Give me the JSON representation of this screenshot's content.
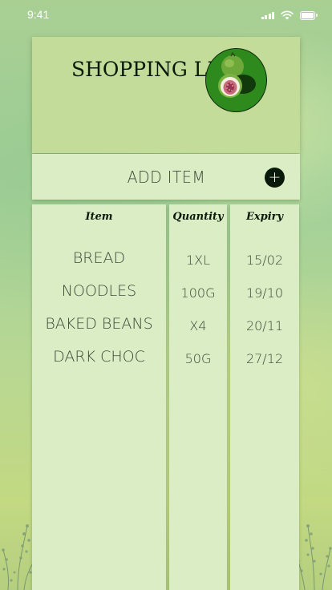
{
  "status_bar": {
    "time": "9:41"
  },
  "header": {
    "title": "SHOPPING LIST",
    "logo_icon": "fig-fruit-icon"
  },
  "add_item": {
    "label": "ADD ITEM",
    "icon": "plus-circle-icon"
  },
  "table": {
    "columns": {
      "item": "Item",
      "quantity": "Quantity",
      "expiry": "Expiry"
    },
    "rows": [
      {
        "item": "BREAD",
        "quantity": "1XL",
        "expiry": "15/02"
      },
      {
        "item": "NOODLES",
        "quantity": "100G",
        "expiry": "19/10"
      },
      {
        "item": "BAKED BEANS",
        "quantity": "X4",
        "expiry": "20/11"
      },
      {
        "item": "DARK CHOC",
        "quantity": "50G",
        "expiry": "27/12"
      }
    ]
  },
  "colors": {
    "background": "#a9cf93",
    "header_card": "#c3dc99",
    "panel": "#daedc4",
    "text_dark": "#0a1a0a",
    "text_muted": "#3b4a3b",
    "logo_circle": "#2f8a1e"
  }
}
